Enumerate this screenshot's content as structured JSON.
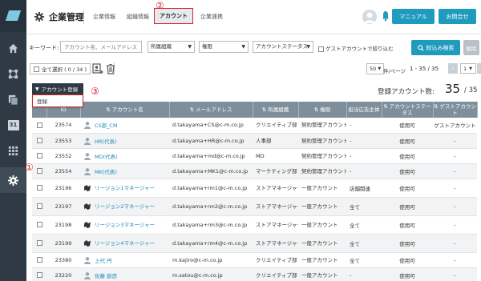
{
  "header": {
    "title": "企業管理",
    "tabs": [
      {
        "label": "企業情報",
        "active": false
      },
      {
        "label": "組織情報",
        "active": false
      },
      {
        "label": "アカウント",
        "active": true
      },
      {
        "label": "企業連携",
        "active": false
      }
    ],
    "manual_label": "マニュアル",
    "contact_label": "お問合せ"
  },
  "sidebar": {
    "items": [
      {
        "icon": "home-icon",
        "active": false
      },
      {
        "icon": "network-icon",
        "active": false
      },
      {
        "icon": "copy-pages-icon",
        "active": false
      },
      {
        "icon": "calendar-icon",
        "label": "31",
        "active": false
      },
      {
        "icon": "grid-icon",
        "active": false
      },
      {
        "icon": "folder-icon",
        "active": false
      },
      {
        "icon": "gear-icon",
        "active": true
      }
    ]
  },
  "search": {
    "keyword_label": "キーワード:",
    "keyword_placeholder": "アカウント名、メールアドレス",
    "org_select": "所属組織",
    "role_select": "権限",
    "status_select": "アカウントステータス",
    "guest_label": "ゲストアカウントで絞り込む",
    "search_button": "絞込み検索",
    "clear_button": "解除"
  },
  "toolbar": {
    "select_all": "全て選択 ( 0 / 34 )",
    "per_page_value": "50",
    "per_page_label": "件/ページ",
    "range": "1 - 35 / 35",
    "page_value": "1"
  },
  "register": {
    "button_label": "アカウント登録",
    "menu_item": "登録"
  },
  "markers": [
    "①",
    "②",
    "③"
  ],
  "count": {
    "label": "登録アカウント数:",
    "value": "35",
    "total": "/ 35"
  },
  "table": {
    "columns": [
      "ID",
      "アカウント名",
      "メールアドレス",
      "所属組織",
      "権限",
      "担当広告主体",
      "アカウントステータス",
      "ゲストアカウント"
    ],
    "rows": [
      {
        "id": "23574",
        "name": "CS部_CM",
        "email": "d.takayama+CS@c-m.co.jp",
        "org": "クリエイティブ部",
        "role": "契約管理アカウント",
        "adv": "-",
        "status": "使用可",
        "guest": "ゲストアカウント"
      },
      {
        "id": "23553",
        "name": "HR(代表)",
        "email": "d.takayama+HR@c-m.co.jp",
        "org": "人事部",
        "role": "契約管理アカウント",
        "adv": "-",
        "status": "使用可",
        "guest": "-"
      },
      {
        "id": "23552",
        "name": "MD(代表)",
        "email": "d.takayama+md@c-m.co.jp",
        "org": "MD",
        "role": "契約管理アカウント",
        "adv": "-",
        "status": "使用可",
        "guest": "-"
      },
      {
        "id": "23554",
        "name": "MK(代表)",
        "email": "d.takayama+MK1@c-m.co.jp",
        "org": "マーケティング部",
        "role": "契約管理アカウント",
        "adv": "-",
        "status": "使用可",
        "guest": "-"
      },
      {
        "id": "23196",
        "name": "リージョン1マネージャー",
        "email": "d.takayama+rm1@c-m.co.jp",
        "org": "ストアマネージャー",
        "role": "一般アカウント",
        "adv": "店舗関連",
        "status": "使用可",
        "guest": "-"
      },
      {
        "id": "23197",
        "name": "リージョン2マネージャー",
        "email": "d.takayama+rm2@c-m.co.jp",
        "org": "ストアマネージャー",
        "role": "一般アカウント",
        "adv": "全て",
        "status": "使用可",
        "guest": "-"
      },
      {
        "id": "23198",
        "name": "リージョン3マネージャー",
        "email": "d.takayama+rm3@c-m.co.jp",
        "org": "ストアマネージャー",
        "role": "一般アカウント",
        "adv": "全て",
        "status": "使用可",
        "guest": "-"
      },
      {
        "id": "23199",
        "name": "リージョン4マネージャー",
        "email": "d.takayama+rm4@c-m.co.jp",
        "org": "ストアマネージャー",
        "role": "一般アカウント",
        "adv": "全て",
        "status": "使用可",
        "guest": "-"
      },
      {
        "id": "23380",
        "name": "上代 円",
        "email": "m.kajiro@c-m.co.jp",
        "org": "クリエイティブ部",
        "role": "一般アカウント",
        "adv": "全て",
        "status": "使用可",
        "guest": "-"
      },
      {
        "id": "23220",
        "name": "佐藤 創彦",
        "email": "m.satou@c-m.co.jp",
        "org": "クリエイティブ部",
        "role": "一般アカウント",
        "adv": "-",
        "status": "使用可",
        "guest": "-"
      }
    ]
  },
  "colors": {
    "accent": "#1f9bbd",
    "sidebar": "#2f3a45",
    "table_header": "#7e8f9b",
    "marker": "#d9262c"
  }
}
